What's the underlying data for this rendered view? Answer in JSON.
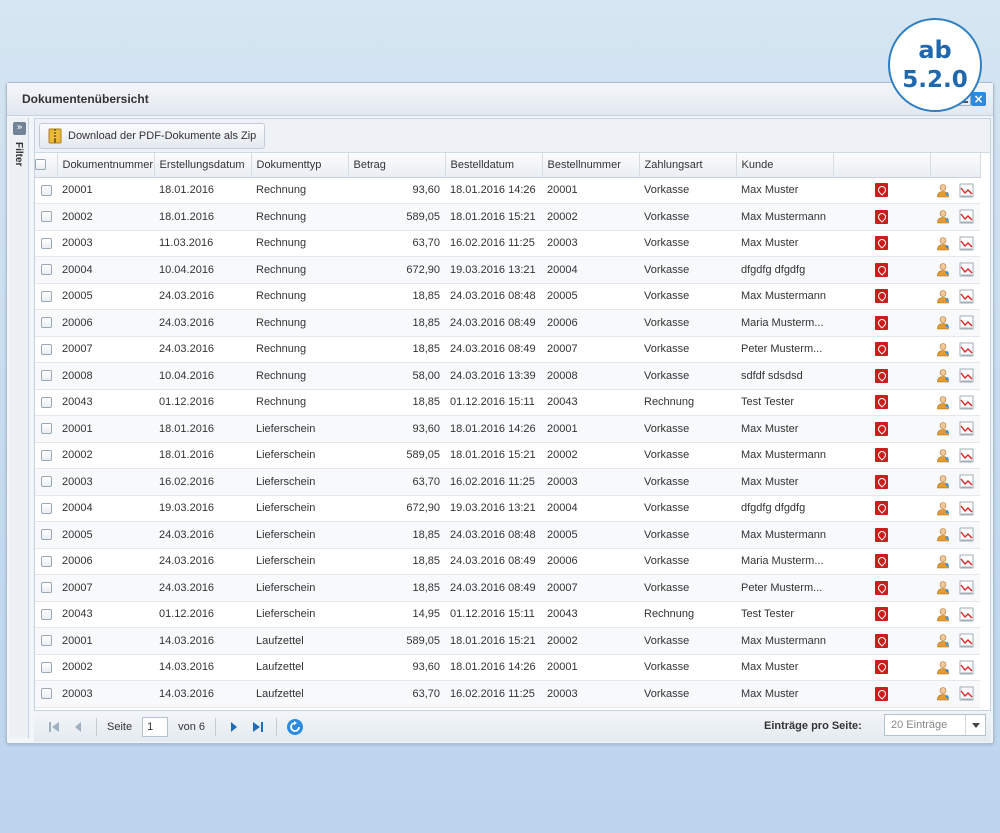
{
  "badge": {
    "line1": "ab",
    "line2": "5.2.0"
  },
  "window": {
    "title": "Dokumentenübersicht",
    "close_glyph": "×"
  },
  "filter": {
    "label": "Filter",
    "expand_glyph": "»"
  },
  "toolbar": {
    "zip_label": "Download der PDF-Dokumente als Zip"
  },
  "columns": {
    "docnum": "Dokumentnummer",
    "created": "Erstellungsdatum",
    "type": "Dokumenttyp",
    "amount": "Betrag",
    "orderdate": "Bestelldatum",
    "ordernum": "Bestellnummer",
    "payment": "Zahlungsart",
    "customer": "Kunde"
  },
  "rows": [
    {
      "docnum": "20001",
      "created": "18.01.2016",
      "type": "Rechnung",
      "amount": "93,60",
      "orderdate": "18.01.2016 14:26",
      "ordernum": "20001",
      "payment": "Vorkasse",
      "customer": "Max Muster"
    },
    {
      "docnum": "20002",
      "created": "18.01.2016",
      "type": "Rechnung",
      "amount": "589,05",
      "orderdate": "18.01.2016 15:21",
      "ordernum": "20002",
      "payment": "Vorkasse",
      "customer": "Max Mustermann"
    },
    {
      "docnum": "20003",
      "created": "11.03.2016",
      "type": "Rechnung",
      "amount": "63,70",
      "orderdate": "16.02.2016 11:25",
      "ordernum": "20003",
      "payment": "Vorkasse",
      "customer": "Max Muster"
    },
    {
      "docnum": "20004",
      "created": "10.04.2016",
      "type": "Rechnung",
      "amount": "672,90",
      "orderdate": "19.03.2016 13:21",
      "ordernum": "20004",
      "payment": "Vorkasse",
      "customer": "dfgdfg dfgdfg"
    },
    {
      "docnum": "20005",
      "created": "24.03.2016",
      "type": "Rechnung",
      "amount": "18,85",
      "orderdate": "24.03.2016 08:48",
      "ordernum": "20005",
      "payment": "Vorkasse",
      "customer": "Max Mustermann"
    },
    {
      "docnum": "20006",
      "created": "24.03.2016",
      "type": "Rechnung",
      "amount": "18,85",
      "orderdate": "24.03.2016 08:49",
      "ordernum": "20006",
      "payment": "Vorkasse",
      "customer": "Maria Musterm..."
    },
    {
      "docnum": "20007",
      "created": "24.03.2016",
      "type": "Rechnung",
      "amount": "18,85",
      "orderdate": "24.03.2016 08:49",
      "ordernum": "20007",
      "payment": "Vorkasse",
      "customer": "Peter Musterm..."
    },
    {
      "docnum": "20008",
      "created": "10.04.2016",
      "type": "Rechnung",
      "amount": "58,00",
      "orderdate": "24.03.2016 13:39",
      "ordernum": "20008",
      "payment": "Vorkasse",
      "customer": "sdfdf sdsdsd"
    },
    {
      "docnum": "20043",
      "created": "01.12.2016",
      "type": "Rechnung",
      "amount": "18,85",
      "orderdate": "01.12.2016 15:11",
      "ordernum": "20043",
      "payment": "Rechnung",
      "customer": "Test Tester"
    },
    {
      "docnum": "20001",
      "created": "18.01.2016",
      "type": "Lieferschein",
      "amount": "93,60",
      "orderdate": "18.01.2016 14:26",
      "ordernum": "20001",
      "payment": "Vorkasse",
      "customer": "Max Muster"
    },
    {
      "docnum": "20002",
      "created": "18.01.2016",
      "type": "Lieferschein",
      "amount": "589,05",
      "orderdate": "18.01.2016 15:21",
      "ordernum": "20002",
      "payment": "Vorkasse",
      "customer": "Max Mustermann"
    },
    {
      "docnum": "20003",
      "created": "16.02.2016",
      "type": "Lieferschein",
      "amount": "63,70",
      "orderdate": "16.02.2016 11:25",
      "ordernum": "20003",
      "payment": "Vorkasse",
      "customer": "Max Muster"
    },
    {
      "docnum": "20004",
      "created": "19.03.2016",
      "type": "Lieferschein",
      "amount": "672,90",
      "orderdate": "19.03.2016 13:21",
      "ordernum": "20004",
      "payment": "Vorkasse",
      "customer": "dfgdfg dfgdfg"
    },
    {
      "docnum": "20005",
      "created": "24.03.2016",
      "type": "Lieferschein",
      "amount": "18,85",
      "orderdate": "24.03.2016 08:48",
      "ordernum": "20005",
      "payment": "Vorkasse",
      "customer": "Max Mustermann"
    },
    {
      "docnum": "20006",
      "created": "24.03.2016",
      "type": "Lieferschein",
      "amount": "18,85",
      "orderdate": "24.03.2016 08:49",
      "ordernum": "20006",
      "payment": "Vorkasse",
      "customer": "Maria Musterm..."
    },
    {
      "docnum": "20007",
      "created": "24.03.2016",
      "type": "Lieferschein",
      "amount": "18,85",
      "orderdate": "24.03.2016 08:49",
      "ordernum": "20007",
      "payment": "Vorkasse",
      "customer": "Peter Musterm..."
    },
    {
      "docnum": "20043",
      "created": "01.12.2016",
      "type": "Lieferschein",
      "amount": "14,95",
      "orderdate": "01.12.2016 15:11",
      "ordernum": "20043",
      "payment": "Rechnung",
      "customer": "Test Tester"
    },
    {
      "docnum": "20001",
      "created": "14.03.2016",
      "type": "Laufzettel",
      "amount": "589,05",
      "orderdate": "18.01.2016 15:21",
      "ordernum": "20002",
      "payment": "Vorkasse",
      "customer": "Max Mustermann"
    },
    {
      "docnum": "20002",
      "created": "14.03.2016",
      "type": "Laufzettel",
      "amount": "93,60",
      "orderdate": "18.01.2016 14:26",
      "ordernum": "20001",
      "payment": "Vorkasse",
      "customer": "Max Muster"
    },
    {
      "docnum": "20003",
      "created": "14.03.2016",
      "type": "Laufzettel",
      "amount": "63,70",
      "orderdate": "16.02.2016 11:25",
      "ordernum": "20003",
      "payment": "Vorkasse",
      "customer": "Max Muster"
    }
  ],
  "pager": {
    "page_label": "Seite",
    "current_page": "1",
    "of_label": "von 6",
    "per_page_label": "Einträge pro Seite:",
    "per_page_value": "20 Einträge"
  },
  "icons": {
    "pdf": "pdf-icon",
    "customer": "user-icon",
    "order": "chart-icon",
    "zip": "zip-archive-icon"
  },
  "colors": {
    "accent": "#2a8be0",
    "pdf_red": "#cc1c1c",
    "badge_blue": "#1f68ad"
  }
}
